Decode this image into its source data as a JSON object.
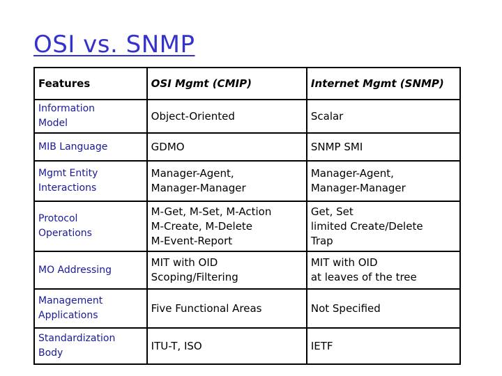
{
  "title": "OSI vs. SNMP",
  "table": {
    "headers": [
      "Features",
      "OSI Mgmt (CMIP)",
      "Internet Mgmt (SNMP)"
    ],
    "rows": [
      {
        "feature": [
          "Information",
          "Model"
        ],
        "osi": [
          "Object-Oriented"
        ],
        "snmp": [
          "Scalar"
        ]
      },
      {
        "feature": [
          "MIB Language"
        ],
        "osi": [
          "GDMO"
        ],
        "snmp": [
          "SNMP SMI"
        ]
      },
      {
        "feature": [
          "Mgmt Entity",
          "Interactions"
        ],
        "osi": [
          "Manager-Agent,",
          "Manager-Manager"
        ],
        "snmp": [
          "Manager-Agent,",
          "Manager-Manager"
        ]
      },
      {
        "feature": [
          "Protocol",
          "Operations"
        ],
        "osi": [
          "M-Get, M-Set, M-Action",
          "M-Create, M-Delete",
          "M-Event-Report"
        ],
        "snmp": [
          "Get, Set",
          "limited Create/Delete",
          "Trap"
        ]
      },
      {
        "feature": [
          "MO Addressing"
        ],
        "osi": [
          "MIT with OID",
          "Scoping/Filtering"
        ],
        "snmp": [
          "MIT with OID",
          "at leaves of the tree"
        ]
      },
      {
        "feature": [
          "Management",
          "Applications"
        ],
        "osi": [
          "Five Functional Areas"
        ],
        "snmp": [
          "Not Specified"
        ]
      },
      {
        "feature": [
          "Standardization",
          "Body"
        ],
        "osi": [
          "ITU-T, ISO"
        ],
        "snmp": [
          "IETF"
        ]
      }
    ]
  },
  "colors": {
    "title": "#3333cc",
    "feature_text": "#1a1a99",
    "border": "#000000"
  }
}
